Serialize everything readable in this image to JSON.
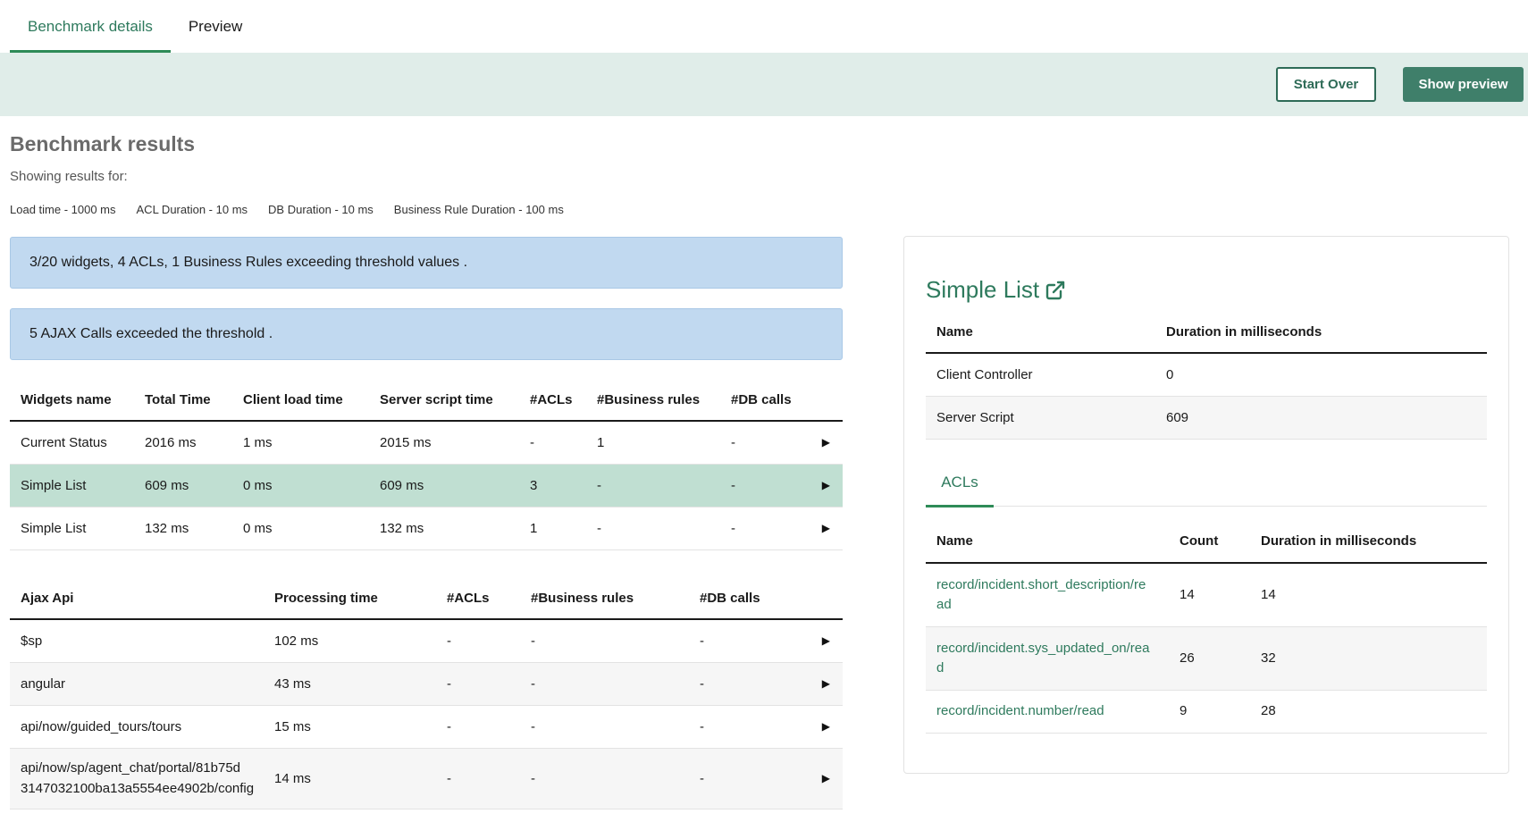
{
  "tabs": [
    {
      "label": "Benchmark details",
      "active": true
    },
    {
      "label": "Preview",
      "active": false
    }
  ],
  "toolbar": {
    "start_over_label": "Start Over",
    "show_preview_label": "Show preview"
  },
  "results": {
    "title": "Benchmark results",
    "showing_label": "Showing results for:",
    "thresholds": [
      "Load time - 1000 ms",
      "ACL Duration - 10 ms",
      "DB Duration - 10 ms",
      "Business Rule Duration - 100 ms"
    ],
    "alerts": [
      "3/20 widgets, 4 ACLs, 1 Business Rules exceeding threshold values .",
      "5 AJAX Calls exceeded the threshold ."
    ]
  },
  "widgets_table": {
    "headers": [
      "Widgets name",
      "Total Time",
      "Client load time",
      "Server script time",
      "#ACLs",
      "#Business rules",
      "#DB calls"
    ],
    "rows": [
      {
        "name": "Current Status",
        "total": "2016 ms",
        "client": "1 ms",
        "server": "2015 ms",
        "acls": "-",
        "br": "1",
        "db": "-"
      },
      {
        "name": "Simple List",
        "total": "609 ms",
        "client": "0 ms",
        "server": "609 ms",
        "acls": "3",
        "br": "-",
        "db": "-"
      },
      {
        "name": "Simple List",
        "total": "132 ms",
        "client": "0 ms",
        "server": "132 ms",
        "acls": "1",
        "br": "-",
        "db": "-"
      }
    ],
    "expand_glyph": "▶",
    "selected_row": 1
  },
  "ajax_table": {
    "headers": [
      "Ajax Api",
      "Processing time",
      "#ACLs",
      "#Business rules",
      "#DB calls"
    ],
    "rows": [
      {
        "api": "$sp",
        "time": "102 ms",
        "acls": "-",
        "br": "-",
        "db": "-"
      },
      {
        "api": "angular",
        "time": "43 ms",
        "acls": "-",
        "br": "-",
        "db": "-"
      },
      {
        "api": "api/now/guided_tours/tours",
        "time": "15 ms",
        "acls": "-",
        "br": "-",
        "db": "-"
      },
      {
        "api_line1": "api/now/sp/agent_chat/portal/81b75d",
        "api_line2": "3147032100ba13a5554ee4902b/config",
        "time": "14 ms",
        "acls": "-",
        "br": "-",
        "db": "-"
      }
    ],
    "expand_glyph": "▶"
  },
  "detail_panel": {
    "title": "Simple List",
    "title_icon": "external-link-icon",
    "headers": [
      "Name",
      "Duration in milliseconds"
    ],
    "rows": [
      {
        "name": "Client Controller",
        "duration": "0"
      },
      {
        "name": "Server Script",
        "duration": "609"
      }
    ],
    "subtab_label": "ACLs",
    "acl_headers": [
      "Name",
      "Count",
      "Duration in milliseconds"
    ],
    "acl_rows": [
      {
        "line1": "record/incident.short_description/re",
        "line2": "ad",
        "count": "14",
        "duration": "14"
      },
      {
        "line1": "record/incident.sys_updated_on/rea",
        "line2": "d",
        "count": "26",
        "duration": "32"
      },
      {
        "line1": "record/incident.number/read",
        "line2": "",
        "count": "9",
        "duration": "28"
      }
    ]
  },
  "colors": {
    "accent": "#2e7a5d",
    "toolbar_bg": "#e0ede9",
    "alert_bg": "#c1d9f0",
    "selected_row_bg": "#c0dfd2"
  }
}
